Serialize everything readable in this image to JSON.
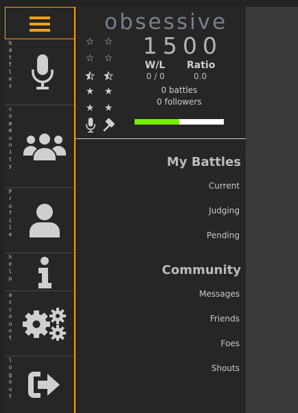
{
  "sidebar": {
    "items": [
      {
        "name": "battles",
        "letters": [
          "b",
          "a",
          "t",
          "t",
          "l",
          "e",
          "s"
        ]
      },
      {
        "name": "community",
        "letters": [
          "c",
          "o",
          "m",
          "m",
          "u",
          "n",
          "i",
          "t",
          "y"
        ]
      },
      {
        "name": "profile",
        "letters": [
          "P",
          "r",
          "o",
          "f",
          "i",
          "l",
          "e"
        ]
      },
      {
        "name": "help",
        "letters": [
          "h",
          "e",
          "l",
          "p"
        ]
      },
      {
        "name": "account",
        "letters": [
          "a",
          "c",
          "c",
          "o",
          "u",
          "n",
          "t"
        ]
      },
      {
        "name": "logout",
        "letters": [
          "l",
          "o",
          "g",
          "o",
          "u",
          "t"
        ]
      }
    ]
  },
  "profile": {
    "username": "obsessive",
    "rating": "1500",
    "wl_label": "W/L",
    "wl_value": "0 / 0",
    "ratio_label": "Ratio",
    "ratio_value": "0.0",
    "battles": "0 battles",
    "followers": "0 followers",
    "progress": 0.5
  },
  "menu": {
    "my_battles_title": "My Battles",
    "my_battles": [
      "Current",
      "Judging",
      "Pending"
    ],
    "community_title": "Community",
    "community": [
      "Messages",
      "Friends",
      "Foes",
      "Shouts"
    ]
  },
  "colors": {
    "accent": "#ff9f1a",
    "progress": "#77ee00",
    "track": "#ffffff"
  }
}
